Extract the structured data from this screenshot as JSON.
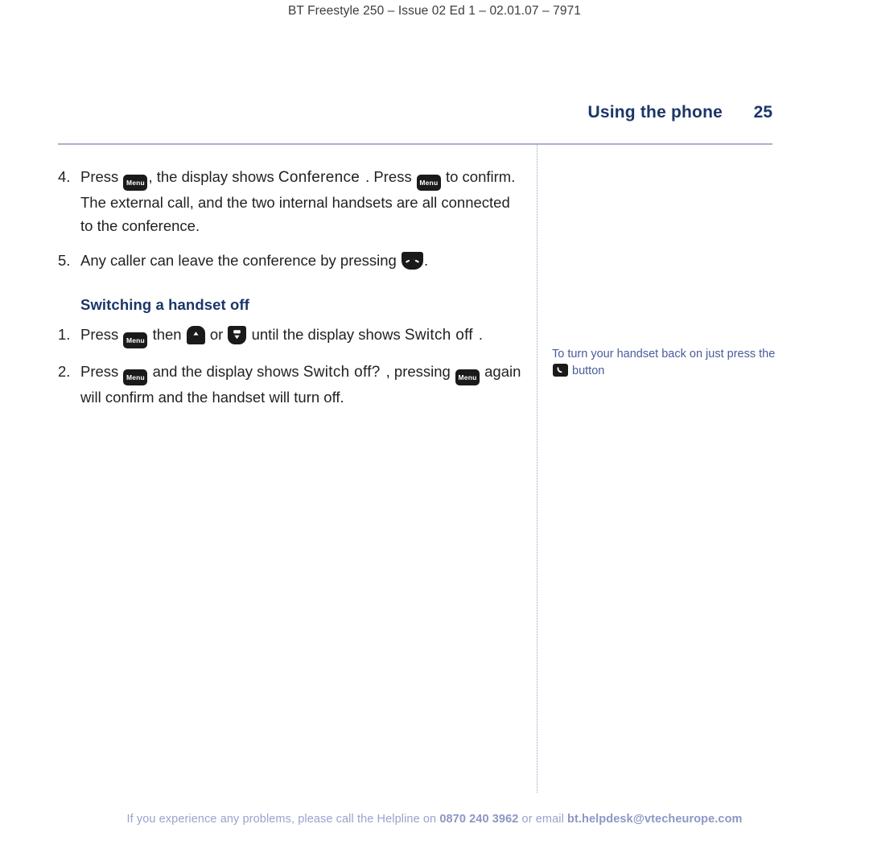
{
  "header": {
    "running_head": "BT Freestyle 250 – Issue 02 Ed 1 – 02.01.07 – 7971"
  },
  "title_row": {
    "chapter_title": "Using the phone",
    "page_number": "25"
  },
  "main": {
    "items": [
      {
        "number": "4.",
        "parts": [
          {
            "type": "text",
            "value": "Press "
          },
          {
            "type": "key",
            "icon": "menu-key-icon",
            "label": "Menu"
          },
          {
            "type": "text",
            "value": ", the display shows "
          },
          {
            "type": "lcd",
            "value": "Conference"
          },
          {
            "type": "text",
            "value": ". Press "
          },
          {
            "type": "key",
            "icon": "menu-key-icon",
            "label": "Menu"
          },
          {
            "type": "text",
            "value": " to confirm. The external call, and the two internal handsets are all connected to the conference."
          }
        ]
      },
      {
        "number": "5.",
        "parts": [
          {
            "type": "text",
            "value": "Any caller can leave the conference by pressing "
          },
          {
            "type": "key",
            "icon": "end-call-key-icon",
            "label": ""
          },
          {
            "type": "text",
            "value": "."
          }
        ]
      }
    ],
    "section_heading": "Switching a handset off",
    "section_items": [
      {
        "number": "1.",
        "parts": [
          {
            "type": "text",
            "value": "Press "
          },
          {
            "type": "key",
            "icon": "menu-key-icon",
            "label": "Menu"
          },
          {
            "type": "text",
            "value": " then "
          },
          {
            "type": "key",
            "icon": "up-arrow-key-icon",
            "label": ""
          },
          {
            "type": "text",
            "value": " or "
          },
          {
            "type": "key",
            "icon": "down-arrow-key-icon",
            "label": ""
          },
          {
            "type": "text",
            "value": " until the display shows "
          },
          {
            "type": "lcd",
            "value": "Switch off"
          },
          {
            "type": "text",
            "value": "."
          }
        ]
      },
      {
        "number": "2.",
        "parts": [
          {
            "type": "text",
            "value": "Press "
          },
          {
            "type": "key",
            "icon": "menu-key-icon",
            "label": "Menu"
          },
          {
            "type": "text",
            "value": " and the display shows "
          },
          {
            "type": "lcd",
            "value": "Switch off?"
          },
          {
            "type": "text",
            "value": ", pressing "
          },
          {
            "type": "key",
            "icon": "menu-key-icon",
            "label": "Menu"
          },
          {
            "type": "text",
            "value": " again will confirm and the handset will turn off."
          }
        ]
      }
    ]
  },
  "side_note": {
    "text_before": "To turn your handset back on just press the ",
    "icon": "talk-key-icon",
    "text_after": " button"
  },
  "footer": {
    "text_before": "If you experience any problems, please call the Helpline on ",
    "phone": "0870 240 3962",
    "text_middle": " or email ",
    "email": "bt.helpdesk@vtecheurope.com"
  },
  "colors": {
    "heading_navy": "#1b3668",
    "side_note_blue": "#4a5b9c",
    "footer_blue": "#9aa3cc",
    "rule_blue": "#aab1cd",
    "key_black": "#1a1a1a"
  },
  "item4_text": {
    "a": "Press ",
    "b": ", the display shows ",
    "c": "Conference",
    "d": ". Press ",
    "e": " to confirm. The external call, and the two internal handsets are all connected to the conference."
  },
  "item5_text": {
    "a": "Any caller can leave the conference by pressing ",
    "b": "."
  },
  "item1_text": {
    "a": "Press ",
    "b": " then ",
    "c": " or ",
    "d": " until the display shows ",
    "e": "Switch off",
    "f": "."
  },
  "item2_text": {
    "a": "Press ",
    "b": " and the display shows ",
    "c": "Switch off?",
    "d": ", pressing ",
    "e": " again will confirm and the handset will turn off."
  },
  "list_numbers": {
    "four": "4.",
    "five": "5.",
    "one": "1.",
    "two": "2."
  },
  "key_labels": {
    "menu": "Menu"
  }
}
